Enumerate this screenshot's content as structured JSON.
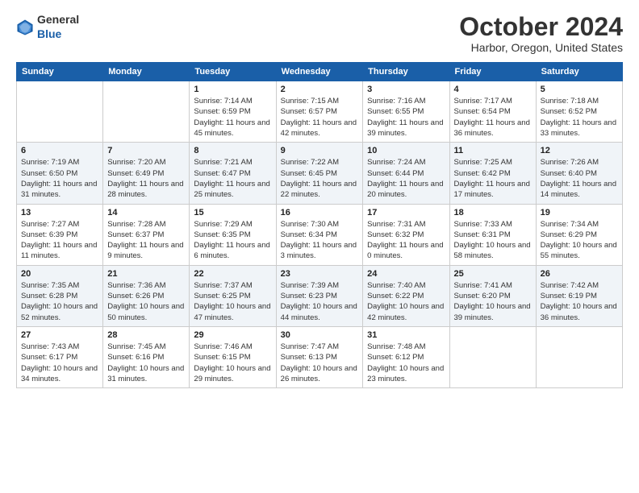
{
  "header": {
    "logo_general": "General",
    "logo_blue": "Blue",
    "month": "October 2024",
    "location": "Harbor, Oregon, United States"
  },
  "weekdays": [
    "Sunday",
    "Monday",
    "Tuesday",
    "Wednesday",
    "Thursday",
    "Friday",
    "Saturday"
  ],
  "weeks": [
    [
      {
        "day": "",
        "sunrise": "",
        "sunset": "",
        "daylight": ""
      },
      {
        "day": "",
        "sunrise": "",
        "sunset": "",
        "daylight": ""
      },
      {
        "day": "1",
        "sunrise": "Sunrise: 7:14 AM",
        "sunset": "Sunset: 6:59 PM",
        "daylight": "Daylight: 11 hours and 45 minutes."
      },
      {
        "day": "2",
        "sunrise": "Sunrise: 7:15 AM",
        "sunset": "Sunset: 6:57 PM",
        "daylight": "Daylight: 11 hours and 42 minutes."
      },
      {
        "day": "3",
        "sunrise": "Sunrise: 7:16 AM",
        "sunset": "Sunset: 6:55 PM",
        "daylight": "Daylight: 11 hours and 39 minutes."
      },
      {
        "day": "4",
        "sunrise": "Sunrise: 7:17 AM",
        "sunset": "Sunset: 6:54 PM",
        "daylight": "Daylight: 11 hours and 36 minutes."
      },
      {
        "day": "5",
        "sunrise": "Sunrise: 7:18 AM",
        "sunset": "Sunset: 6:52 PM",
        "daylight": "Daylight: 11 hours and 33 minutes."
      }
    ],
    [
      {
        "day": "6",
        "sunrise": "Sunrise: 7:19 AM",
        "sunset": "Sunset: 6:50 PM",
        "daylight": "Daylight: 11 hours and 31 minutes."
      },
      {
        "day": "7",
        "sunrise": "Sunrise: 7:20 AM",
        "sunset": "Sunset: 6:49 PM",
        "daylight": "Daylight: 11 hours and 28 minutes."
      },
      {
        "day": "8",
        "sunrise": "Sunrise: 7:21 AM",
        "sunset": "Sunset: 6:47 PM",
        "daylight": "Daylight: 11 hours and 25 minutes."
      },
      {
        "day": "9",
        "sunrise": "Sunrise: 7:22 AM",
        "sunset": "Sunset: 6:45 PM",
        "daylight": "Daylight: 11 hours and 22 minutes."
      },
      {
        "day": "10",
        "sunrise": "Sunrise: 7:24 AM",
        "sunset": "Sunset: 6:44 PM",
        "daylight": "Daylight: 11 hours and 20 minutes."
      },
      {
        "day": "11",
        "sunrise": "Sunrise: 7:25 AM",
        "sunset": "Sunset: 6:42 PM",
        "daylight": "Daylight: 11 hours and 17 minutes."
      },
      {
        "day": "12",
        "sunrise": "Sunrise: 7:26 AM",
        "sunset": "Sunset: 6:40 PM",
        "daylight": "Daylight: 11 hours and 14 minutes."
      }
    ],
    [
      {
        "day": "13",
        "sunrise": "Sunrise: 7:27 AM",
        "sunset": "Sunset: 6:39 PM",
        "daylight": "Daylight: 11 hours and 11 minutes."
      },
      {
        "day": "14",
        "sunrise": "Sunrise: 7:28 AM",
        "sunset": "Sunset: 6:37 PM",
        "daylight": "Daylight: 11 hours and 9 minutes."
      },
      {
        "day": "15",
        "sunrise": "Sunrise: 7:29 AM",
        "sunset": "Sunset: 6:35 PM",
        "daylight": "Daylight: 11 hours and 6 minutes."
      },
      {
        "day": "16",
        "sunrise": "Sunrise: 7:30 AM",
        "sunset": "Sunset: 6:34 PM",
        "daylight": "Daylight: 11 hours and 3 minutes."
      },
      {
        "day": "17",
        "sunrise": "Sunrise: 7:31 AM",
        "sunset": "Sunset: 6:32 PM",
        "daylight": "Daylight: 11 hours and 0 minutes."
      },
      {
        "day": "18",
        "sunrise": "Sunrise: 7:33 AM",
        "sunset": "Sunset: 6:31 PM",
        "daylight": "Daylight: 10 hours and 58 minutes."
      },
      {
        "day": "19",
        "sunrise": "Sunrise: 7:34 AM",
        "sunset": "Sunset: 6:29 PM",
        "daylight": "Daylight: 10 hours and 55 minutes."
      }
    ],
    [
      {
        "day": "20",
        "sunrise": "Sunrise: 7:35 AM",
        "sunset": "Sunset: 6:28 PM",
        "daylight": "Daylight: 10 hours and 52 minutes."
      },
      {
        "day": "21",
        "sunrise": "Sunrise: 7:36 AM",
        "sunset": "Sunset: 6:26 PM",
        "daylight": "Daylight: 10 hours and 50 minutes."
      },
      {
        "day": "22",
        "sunrise": "Sunrise: 7:37 AM",
        "sunset": "Sunset: 6:25 PM",
        "daylight": "Daylight: 10 hours and 47 minutes."
      },
      {
        "day": "23",
        "sunrise": "Sunrise: 7:39 AM",
        "sunset": "Sunset: 6:23 PM",
        "daylight": "Daylight: 10 hours and 44 minutes."
      },
      {
        "day": "24",
        "sunrise": "Sunrise: 7:40 AM",
        "sunset": "Sunset: 6:22 PM",
        "daylight": "Daylight: 10 hours and 42 minutes."
      },
      {
        "day": "25",
        "sunrise": "Sunrise: 7:41 AM",
        "sunset": "Sunset: 6:20 PM",
        "daylight": "Daylight: 10 hours and 39 minutes."
      },
      {
        "day": "26",
        "sunrise": "Sunrise: 7:42 AM",
        "sunset": "Sunset: 6:19 PM",
        "daylight": "Daylight: 10 hours and 36 minutes."
      }
    ],
    [
      {
        "day": "27",
        "sunrise": "Sunrise: 7:43 AM",
        "sunset": "Sunset: 6:17 PM",
        "daylight": "Daylight: 10 hours and 34 minutes."
      },
      {
        "day": "28",
        "sunrise": "Sunrise: 7:45 AM",
        "sunset": "Sunset: 6:16 PM",
        "daylight": "Daylight: 10 hours and 31 minutes."
      },
      {
        "day": "29",
        "sunrise": "Sunrise: 7:46 AM",
        "sunset": "Sunset: 6:15 PM",
        "daylight": "Daylight: 10 hours and 29 minutes."
      },
      {
        "day": "30",
        "sunrise": "Sunrise: 7:47 AM",
        "sunset": "Sunset: 6:13 PM",
        "daylight": "Daylight: 10 hours and 26 minutes."
      },
      {
        "day": "31",
        "sunrise": "Sunrise: 7:48 AM",
        "sunset": "Sunset: 6:12 PM",
        "daylight": "Daylight: 10 hours and 23 minutes."
      },
      {
        "day": "",
        "sunrise": "",
        "sunset": "",
        "daylight": ""
      },
      {
        "day": "",
        "sunrise": "",
        "sunset": "",
        "daylight": ""
      }
    ]
  ]
}
